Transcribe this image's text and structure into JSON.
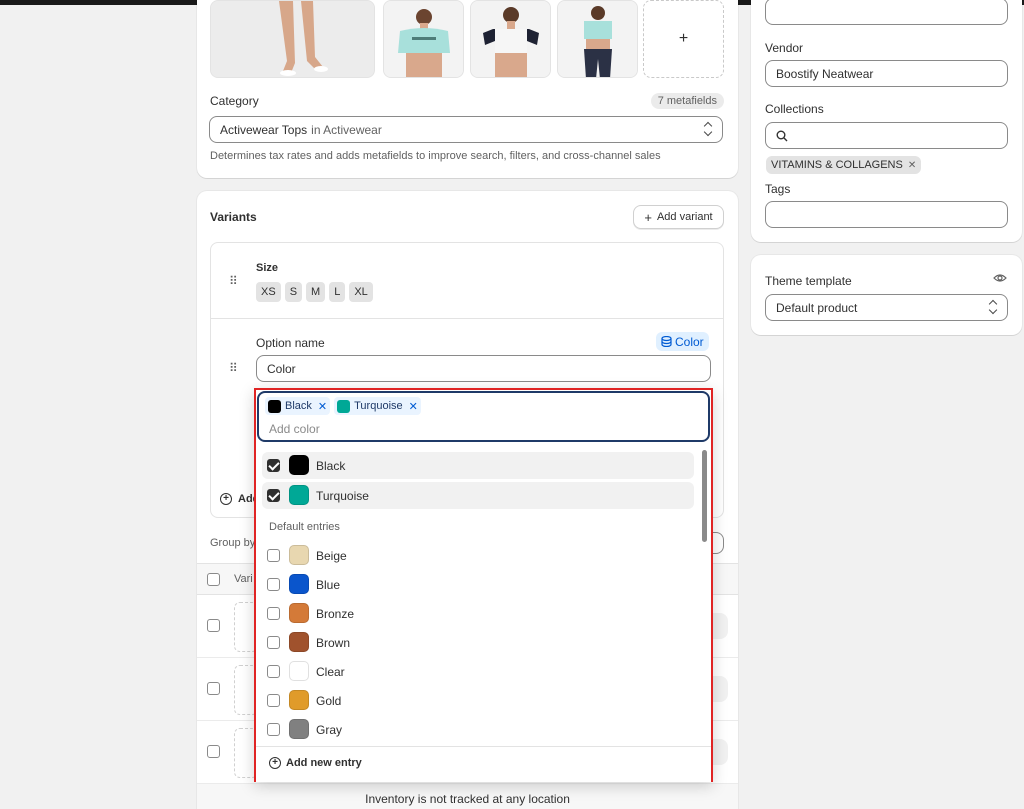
{
  "product_media": {
    "add_label": "+"
  },
  "category": {
    "label": "Category",
    "metafields_badge": "7 metafields",
    "value_main": "Activewear Tops",
    "value_suffix": "in Activewear",
    "help": "Determines tax rates and adds metafields to improve search, filters, and cross-channel sales"
  },
  "variants": {
    "title": "Variants",
    "add_variant_label": "Add variant",
    "size_option": {
      "name": "Size",
      "values": [
        "XS",
        "S",
        "M",
        "L",
        "XL"
      ]
    },
    "option_name_label": "Option name",
    "metaobject_badge": "Color",
    "option_name_value": "Color",
    "add_another_partial": "Add",
    "group_by_partial": "Group by",
    "table_header_partial": "Vari",
    "inventory_note": "Inventory is not tracked at any location"
  },
  "color_picker": {
    "selected_tags": [
      {
        "label": "Black",
        "color": "#000000"
      },
      {
        "label": "Turquoise",
        "color": "#00a896"
      }
    ],
    "add_placeholder": "Add color",
    "selected_entries": [
      {
        "label": "Black",
        "color": "#000000",
        "checked": true
      },
      {
        "label": "Turquoise",
        "color": "#00a896",
        "checked": true
      }
    ],
    "default_heading": "Default entries",
    "default_entries": [
      {
        "label": "Beige",
        "color": "#e8d7b0"
      },
      {
        "label": "Blue",
        "color": "#0a55cc"
      },
      {
        "label": "Bronze",
        "color": "#d47a38"
      },
      {
        "label": "Brown",
        "color": "#a0522d"
      },
      {
        "label": "Clear",
        "color": "#ffffff"
      },
      {
        "label": "Gold",
        "color": "#e09b2a"
      },
      {
        "label": "Gray",
        "color": "#808080"
      }
    ],
    "add_new_entry_label": "Add new entry",
    "highlight_color": "#e02424"
  },
  "sidebar": {
    "vendor_label": "Vendor",
    "vendor_value": "Boostify Neatwear",
    "collections_label": "Collections",
    "collection_tag": "VITAMINS & COLLAGENS",
    "tags_label": "Tags",
    "theme_label": "Theme template",
    "theme_value": "Default product"
  }
}
